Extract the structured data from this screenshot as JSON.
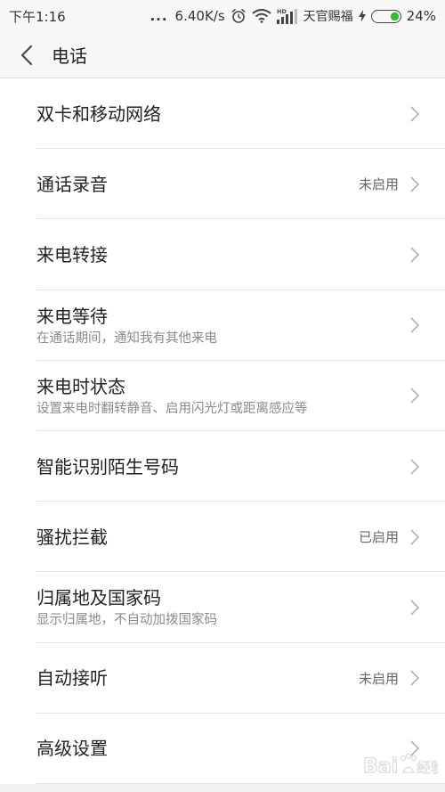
{
  "status_bar": {
    "time": "下午1:16",
    "dots": "...",
    "speed": "6.40K/s",
    "icons": [
      "alarm-icon",
      "wifi-icon",
      "hd-signal-icon"
    ],
    "carrier": "天官赐福",
    "battery_percent": "24%",
    "battery_level": 0.24,
    "battery_color": "#2fbf2f"
  },
  "header": {
    "back_icon": "chevron-left-icon",
    "title": "电话"
  },
  "items": [
    {
      "title": "双卡和移动网络",
      "subtitle": "",
      "value": ""
    },
    {
      "title": "通话录音",
      "subtitle": "",
      "value": "未启用"
    },
    {
      "title": "来电转接",
      "subtitle": "",
      "value": ""
    },
    {
      "title": "来电等待",
      "subtitle": "在通话期间，通知我有其他来电",
      "value": ""
    },
    {
      "title": "来电时状态",
      "subtitle": "设置来电时翻转静音、启用闪光灯或距离感应等",
      "value": ""
    },
    {
      "title": "智能识别陌生号码",
      "subtitle": "",
      "value": ""
    },
    {
      "title": "骚扰拦截",
      "subtitle": "",
      "value": "已启用"
    },
    {
      "title": "归属地及国家码",
      "subtitle": "显示归属地，不自动加拨国家码",
      "value": ""
    },
    {
      "title": "自动接听",
      "subtitle": "",
      "value": "未启用"
    },
    {
      "title": "高级设置",
      "subtitle": "",
      "value": ""
    }
  ],
  "watermark": {
    "brand_latin": "Bai",
    "brand_cn": "经验"
  }
}
